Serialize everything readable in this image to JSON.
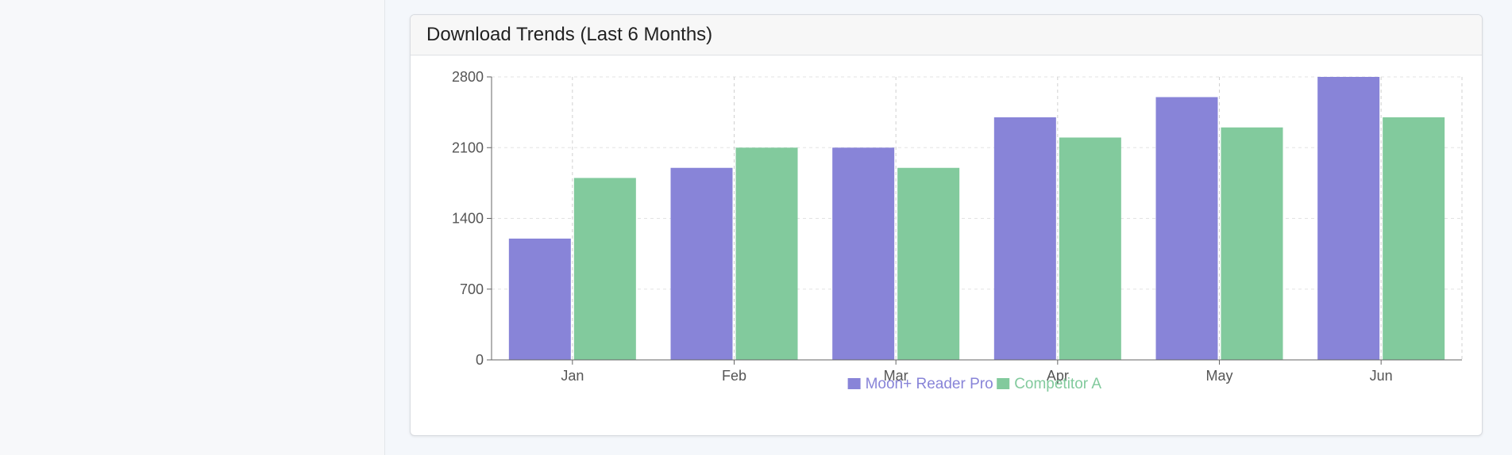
{
  "card": {
    "title": "Download Trends (Last 6 Months)"
  },
  "chart_data": {
    "type": "bar",
    "title": "Download Trends (Last 6 Months)",
    "categories": [
      "Jan",
      "Feb",
      "Mar",
      "Apr",
      "May",
      "Jun"
    ],
    "series": [
      {
        "name": "Moon+ Reader Pro",
        "color": "#8884d8",
        "values": [
          1200,
          1900,
          2100,
          2400,
          2600,
          2800
        ]
      },
      {
        "name": "Competitor A",
        "color": "#82ca9d",
        "values": [
          1800,
          2100,
          1900,
          2200,
          2300,
          2400
        ]
      }
    ],
    "yticks": [
      0,
      700,
      1400,
      2100,
      2800
    ],
    "ylim": [
      0,
      2800
    ],
    "grid": true,
    "legend": "bottom-center"
  }
}
